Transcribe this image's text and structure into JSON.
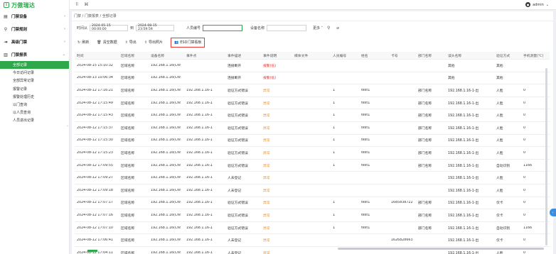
{
  "app": {
    "logo_mark": "↕",
    "title": "万傲瑞达"
  },
  "sidebar": {
    "groups": [
      {
        "label": "门禁设备",
        "icon": "device-icon",
        "glyph": "▤",
        "chev": "›"
      },
      {
        "label": "门禁规则",
        "icon": "rule-icon",
        "glyph": "⚲",
        "chev": "›"
      },
      {
        "label": "高级门禁",
        "icon": "advanced-icon",
        "glyph": "⇥",
        "chev": "›"
      },
      {
        "label": "门禁报表",
        "icon": "report-icon",
        "glyph": "▥",
        "chev": "⌄"
      }
    ],
    "items": [
      {
        "label": "全部记录",
        "active": true
      },
      {
        "label": "今日访问记录"
      },
      {
        "label": "全部异常记录"
      },
      {
        "label": "报警记录"
      },
      {
        "label": "报警处理历史"
      },
      {
        "label": "以门查询"
      },
      {
        "label": "以人员查询"
      },
      {
        "label": "人员进出记录"
      }
    ]
  },
  "topbar": {
    "grid_glyph": "⠿",
    "cmd_glyph": "⌘",
    "user": "admin",
    "user_chev": "⌄"
  },
  "breadcrumb": "门禁 / 门禁报表 / 全部记录",
  "filter": {
    "time_label": "时间从",
    "time_from": "2024-05-15 00:00:00",
    "to_label": "到",
    "time_to": "2024-08-15 23:59:59",
    "pin_label": "人员编号",
    "pin_value": "",
    "device_label": "设备名称",
    "device_value": "",
    "more_label": "更多 ˅",
    "search_glyph": "⚲",
    "clear_glyph": "⌀"
  },
  "toolbar": {
    "refresh": "刷新",
    "clear": "清空数据",
    "export": "导出",
    "export_photo": "导出照片",
    "esd": "ESD门禁看板",
    "refresh_glyph": "↻",
    "clear_glyph": "🗑",
    "export_glyph": "⇪",
    "export_photo_glyph": "⇪",
    "esd_glyph": "👥"
  },
  "table": {
    "columns": [
      "时间",
      "区域名称",
      "设备名称",
      "事件点",
      "事件描述",
      "事件说明",
      "媒体文件",
      "人员编号",
      "姓名",
      "卡号",
      "部门名称",
      "读头名称",
      "验证方式",
      "手机测量(℃)"
    ],
    "rows": [
      [
        "2024-08-15 15:10:32",
        "区域名称",
        "192.168.1.16(CN!",
        "",
        "连接断开",
        "报警(低)",
        "",
        "",
        "",
        "",
        "",
        "其他",
        "其他",
        ""
      ],
      [
        "2024-08-13 10:06:34",
        "区域名称",
        "192.168.1.16(CN!",
        "",
        "连接断开",
        "报警(低)",
        "",
        "",
        "",
        "",
        "",
        "其他",
        "其他",
        ""
      ],
      [
        "2024-08-12 17:16:21",
        "区域名称",
        "192.168.1.16(CN!",
        "192.168.1.16-1",
        "验证方式错误",
        "异常",
        "",
        "1",
        "test1",
        "",
        "部门名称",
        "192.168.1.16-1-出",
        "人脸",
        "0"
      ],
      [
        "2024-08-12 17:15:49",
        "区域名称",
        "192.168.1.16(CN!",
        "192.168.1.16-1",
        "验证方式错误",
        "异常",
        "",
        "1",
        "test1",
        "",
        "部门名称",
        "192.168.1.16-1-出",
        "人脸",
        "0"
      ],
      [
        "2024-08-12 17:15:43",
        "区域名称",
        "192.168.1.16(CN!",
        "192.168.1.16-1",
        "验证方式错误",
        "异常",
        "",
        "1",
        "test1",
        "",
        "部门名称",
        "192.168.1.16-1-出",
        "人脸",
        "0"
      ],
      [
        "2024-08-12 17:15:37",
        "区域名称",
        "192.168.1.16(CN!",
        "192.168.1.16-1",
        "验证方式错误",
        "异常",
        "",
        "1",
        "test1",
        "",
        "部门名称",
        "192.168.1.16-1-出",
        "人脸",
        "0"
      ],
      [
        "2024-08-12 17:15:30",
        "区域名称",
        "192.168.1.16(CN!",
        "192.168.1.16-1",
        "验证方式错误",
        "异常",
        "",
        "1",
        "test1",
        "",
        "部门名称",
        "192.168.1.16-1-出",
        "人脸",
        "0"
      ],
      [
        "2024-08-12 17:15:23",
        "区域名称",
        "192.168.1.16(CN!",
        "192.168.1.16-1",
        "验证方式错误",
        "异常",
        "",
        "1",
        "test1",
        "",
        "部门名称",
        "192.168.1.16-1-出",
        "人脸",
        "0"
      ],
      [
        "2024-08-12 17:09:55",
        "区域名称",
        "192.168.1.16(CN!",
        "192.168.1.16-1",
        "验证方式错误",
        "异常",
        "",
        "1",
        "test1",
        "",
        "部门名称",
        "192.168.1.16-1-出",
        "自动识别",
        "1166"
      ],
      [
        "2024-08-12 17:09:27",
        "区域名称",
        "192.168.1.16(CN!",
        "192.168.1.16-1",
        "人未登记",
        "异常",
        "",
        "",
        "",
        "",
        "",
        "192.168.1.16-1-出",
        "人脸",
        "0"
      ],
      [
        "2024-08-12 17:09:18",
        "区域名称",
        "192.168.1.16(CN!",
        "192.168.1.16-1",
        "人未登记",
        "异常",
        "",
        "",
        "",
        "",
        "",
        "192.168.1.16-1-出",
        "人脸",
        "0"
      ],
      [
        "2024-08-12 17:07:17",
        "区域名称",
        "192.168.1.16(CN!",
        "192.168.1.16-1",
        "验证方式错误",
        "异常",
        "",
        "1",
        "test1",
        "1685838722",
        "部门名称",
        "192.168.1.16-1-出",
        "仅卡",
        "0"
      ],
      [
        "2024-08-12 17:07:16",
        "区域名称",
        "192.168.1.16(CN!",
        "192.168.1.16-1",
        "验证方式错误",
        "异常",
        "",
        "1",
        "test1",
        "",
        "部门名称",
        "192.168.1.16-1-出",
        "仅卡",
        "0"
      ],
      [
        "2024-08-12 17:07:10",
        "区域名称",
        "192.168.1.16(CN!",
        "192.168.1.16-1",
        "验证方式错误",
        "异常",
        "",
        "1",
        "test1",
        "",
        "部门名称",
        "192.168.1.16-1-出",
        "自动识别",
        "1166"
      ],
      [
        "2024-08-12 17:06:41",
        "区域名称",
        "192.168.1.16(CN!",
        "192.168.1.16-1",
        "人未登记",
        "异常",
        "",
        "",
        "",
        "1626828663",
        "",
        "192.168.1.16-1-出",
        "仅卡",
        "0"
      ],
      [
        "2024-08-12 17:04:11",
        "区域名称",
        "192.168.1.16(CN!",
        "192.168.1.16-1",
        "人未登记",
        "异常",
        "",
        "",
        "",
        "",
        "",
        "192.168.1.16-1-出",
        "人脸",
        "0"
      ]
    ]
  },
  "colors": {
    "brand": "#2ea84a",
    "alarm": "#e53935",
    "exception": "#f0932b",
    "highlight_border": "#e53935"
  },
  "float_tab_glyph": "‹",
  "collapse_glyph": "‹"
}
